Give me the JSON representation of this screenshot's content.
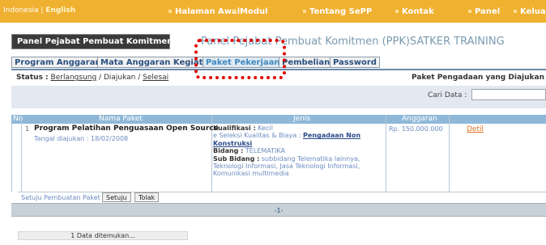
{
  "lang": {
    "first": "Indonesia",
    "sep": " | ",
    "second": "English"
  },
  "nav": [
    "Halaman Awal",
    "Modul",
    "Tentang SePP",
    "Kontak",
    "Panel",
    "Keluar"
  ],
  "panel_title": "Panel Pejabat Pembuat Komitmen",
  "page_heading": "Panel Pejabat Pembuat Komitmen (PPK)SATKER TRAINING",
  "tabs": [
    "Program Anggaran",
    "Mata Anggaran Kegiatan",
    "Paket Pekerjaan",
    "Pembelian",
    "Password"
  ],
  "status": {
    "label": "Status :",
    "opt1": "Berlangsung",
    "sep": " / ",
    "opt2": "Diajukan",
    "opt3": "Selesai"
  },
  "right_heading": "Paket Pengadaan yang Diajukan",
  "search": {
    "label": "Cari Data :"
  },
  "table": {
    "headers": {
      "no": "No",
      "nama": "Nama Paket",
      "jenis": "Jenis",
      "anggaran": "Anggaran"
    },
    "row": {
      "no": "1",
      "name": "Program Pelatihan Penguasaan Open Source",
      "date": "Tangal diajukan : 18/02/2008",
      "kualifikasi_label": "Kualifikasi :",
      "kualifikasi": "Kecil",
      "seleksi_label": "e Seleksi Kualitas & Biaya :",
      "seleksi_link": "Pengadaan Non Konstruksi",
      "bidang_label": "Bidang :",
      "bidang": "TELEMATIKA",
      "subbidang_label": "Sub Bidang :",
      "subbidang": "subbidang Telematika lainnya, Teknologi Informasi, Jasa Teknologi Informasi, Komunikasi multimedia",
      "anggaran": "Rp. 150.000.000",
      "action": "Detil"
    }
  },
  "approve": {
    "label": "Setuju Pembuatan Paket ?",
    "yes": "Setuju",
    "no": "Tolak"
  },
  "pager": "-1-",
  "found": "1 Data ditemukan...",
  "colors": {
    "topbar": "#f0b030",
    "highlight": "#e00000"
  }
}
